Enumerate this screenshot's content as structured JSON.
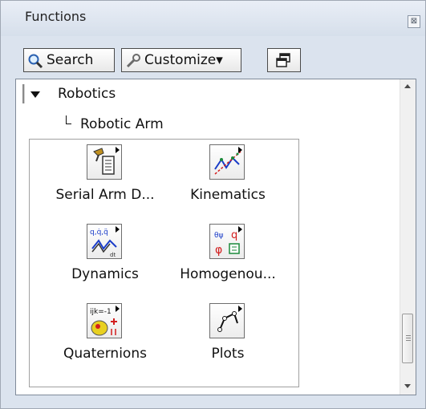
{
  "window": {
    "title": "Functions",
    "close_label": "⊠"
  },
  "toolbar": {
    "search_label": "Search",
    "customize_label": "Customize▾"
  },
  "tree": {
    "category": "Robotics",
    "subcategory": "Robotic Arm"
  },
  "palette": {
    "items": [
      {
        "label": "Serial Arm D...",
        "icon": "serial-arm-icon"
      },
      {
        "label": "Kinematics",
        "icon": "kinematics-icon"
      },
      {
        "label": "Dynamics",
        "icon": "dynamics-icon"
      },
      {
        "label": "Homogenou...",
        "icon": "homogeneous-icon"
      },
      {
        "label": "Quaternions",
        "icon": "quaternions-icon"
      },
      {
        "label": "Plots",
        "icon": "plots-icon"
      }
    ],
    "icon_texts": {
      "dynamics": "q,q̇,q̈",
      "quaternions": "ijk=-1"
    }
  },
  "colors": {
    "titlebar": "#dbe3ee",
    "accent_blue": "#1a3cc8",
    "accent_red": "#d21e1e"
  }
}
